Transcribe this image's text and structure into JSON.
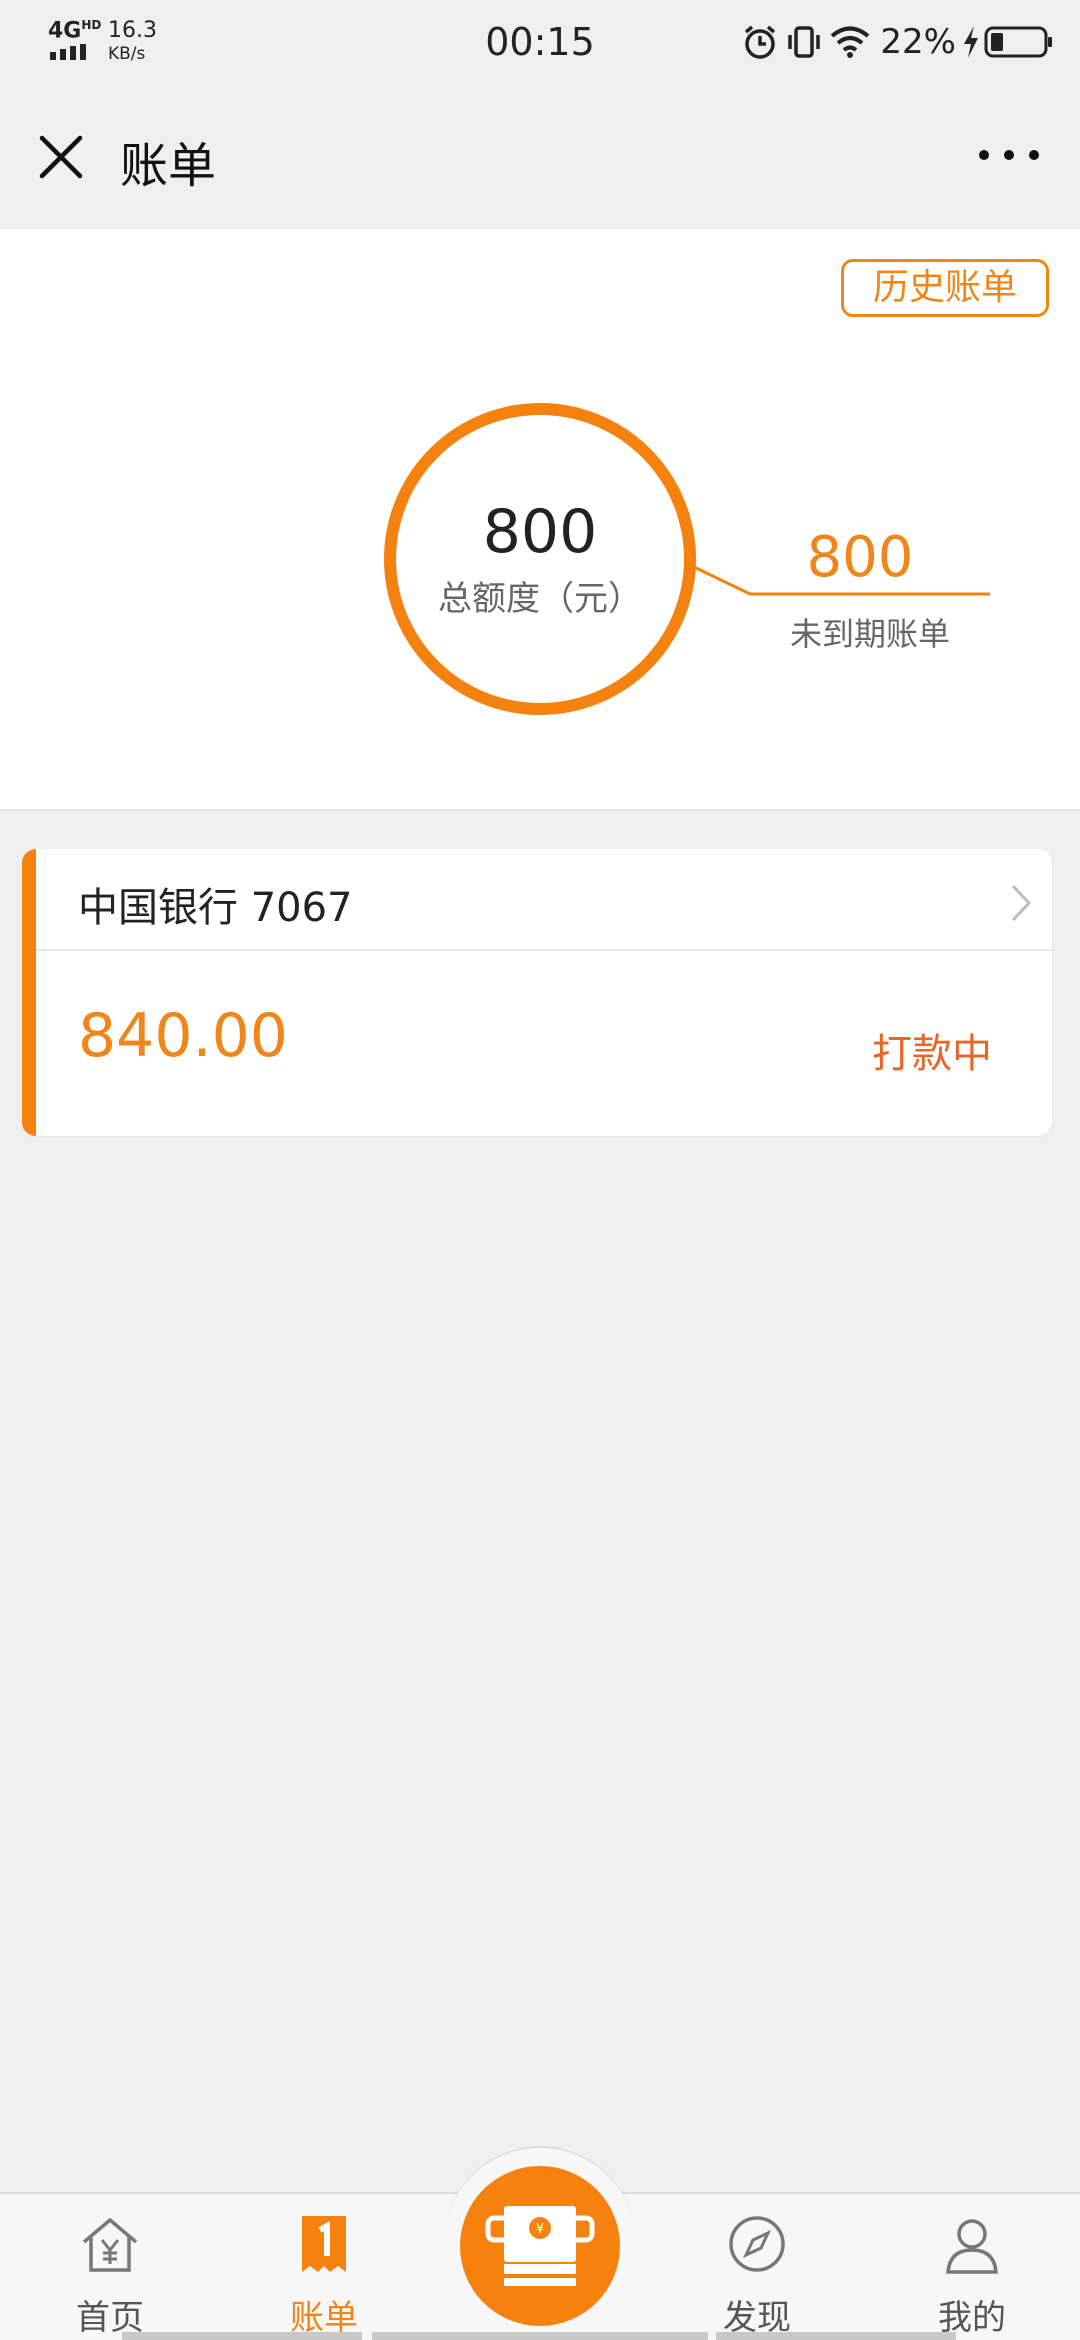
{
  "status_bar": {
    "network": "4G",
    "network_sup": "HD",
    "speed": "16.3",
    "speed_unit": "KB/s",
    "time": "00:15",
    "battery_percent": "22%"
  },
  "nav": {
    "title": "账单",
    "close_icon": "close-icon",
    "more_icon": "more-icon"
  },
  "summary": {
    "history_button": "历史账单",
    "total_value": "800",
    "total_label": "总额度（元）",
    "due_value": "800",
    "due_label": "未到期账单"
  },
  "bill": {
    "bank_name": "中国银行 7067",
    "amount": "840.00",
    "status": "打款中"
  },
  "tabs": [
    {
      "label": "首页",
      "icon": "home-yen-icon",
      "active": false
    },
    {
      "label": "账单",
      "icon": "bill-icon",
      "active": true
    },
    {
      "label": "",
      "icon": "cash-payment-icon",
      "active": false
    },
    {
      "label": "发现",
      "icon": "compass-icon",
      "active": false
    },
    {
      "label": "我的",
      "icon": "user-icon",
      "active": false
    }
  ],
  "colors": {
    "accent": "#f5820f",
    "accent_text": "#f08519",
    "status_text": "#e8652a",
    "background": "#efeff0"
  }
}
